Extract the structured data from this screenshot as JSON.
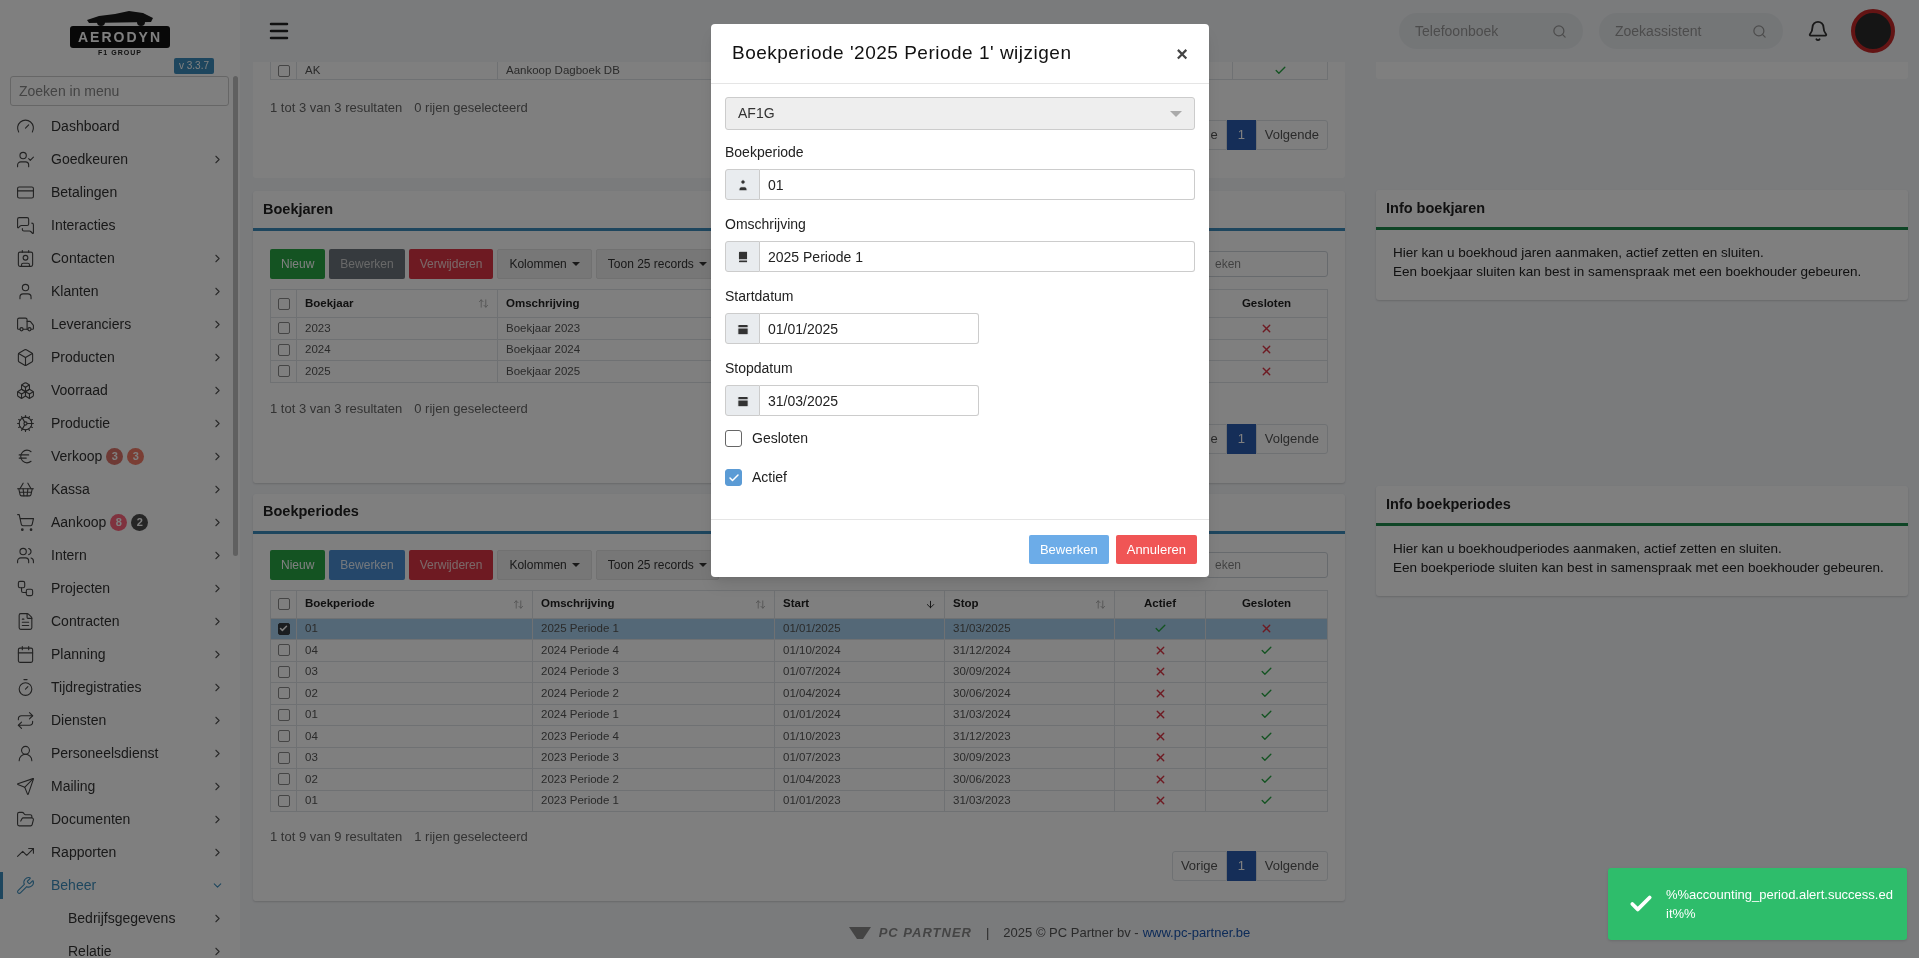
{
  "sidebar": {
    "logo": {
      "name": "AERODYN",
      "tagline": "F1 GROUP"
    },
    "version": "v 3.3.7",
    "search": {
      "placeholder": "Zoeken in menu"
    },
    "items": [
      {
        "label": "Dashboard",
        "selected": false
      },
      {
        "label": "Goedkeuren",
        "selected": false,
        "expanded": false
      },
      {
        "label": "Betalingen",
        "selected": false
      },
      {
        "label": "Interacties",
        "selected": false
      },
      {
        "label": "Contacten",
        "selected": false,
        "expanded": false
      },
      {
        "label": "Klanten",
        "selected": false,
        "expanded": false
      },
      {
        "label": "Leveranciers",
        "selected": false,
        "expanded": false
      },
      {
        "label": "Producten",
        "selected": false,
        "expanded": false
      },
      {
        "label": "Voorraad",
        "selected": false,
        "expanded": false
      },
      {
        "label": "Productie",
        "selected": false,
        "expanded": false
      },
      {
        "label": "Verkoop",
        "selected": false,
        "expanded": false,
        "badges": [
          {
            "text": "3",
            "color": "#6e3a35"
          },
          {
            "text": "3",
            "color": "#7a3e34"
          }
        ]
      },
      {
        "label": "Kassa",
        "selected": false,
        "expanded": false
      },
      {
        "label": "Aankoop",
        "selected": false,
        "expanded": false,
        "badges": [
          {
            "text": "8",
            "color": "#84323e"
          },
          {
            "text": "2",
            "color": "#262626"
          }
        ]
      },
      {
        "label": "Intern",
        "selected": false,
        "expanded": false
      },
      {
        "label": "Projecten",
        "selected": false,
        "expanded": false
      },
      {
        "label": "Contracten",
        "selected": false,
        "expanded": false
      },
      {
        "label": "Planning",
        "selected": false,
        "expanded": false
      },
      {
        "label": "Tijdregistraties",
        "selected": false,
        "expanded": false
      },
      {
        "label": "Diensten",
        "selected": false,
        "expanded": false
      },
      {
        "label": "Personeelsdienst",
        "selected": false,
        "expanded": false
      },
      {
        "label": "Mailing",
        "selected": false,
        "expanded": false
      },
      {
        "label": "Documenten",
        "selected": false,
        "expanded": false
      },
      {
        "label": "Rapporten",
        "selected": false,
        "expanded": false
      },
      {
        "label": "Beheer",
        "selected": true,
        "expanded": true,
        "children": [
          {
            "label": "Bedrijfsgegevens",
            "selected": false,
            "expanded": false
          },
          {
            "label": "Relatie",
            "selected": false,
            "expanded": false
          }
        ]
      }
    ]
  },
  "header": {
    "search_fields": [
      {
        "placeholder": "Telefoonboek"
      },
      {
        "placeholder": "Zoekassistent"
      }
    ]
  },
  "journals_panel": {
    "rows": [
      {
        "code": "AK",
        "description": "Aankoop Dagboek DB",
        "selected": false,
        "column_4": true
      }
    ],
    "summary": "1 tot 3 van 3 resultaten",
    "selection": "0 rijen geselecteerd",
    "pagination": {
      "previous": "e",
      "pages": [
        {
          "label": "1",
          "selected": true
        }
      ],
      "next": "Volgende"
    }
  },
  "years_panel": {
    "title": "Boekjaren",
    "toolbar": [
      {
        "label": "Nieuw",
        "kind": "new"
      },
      {
        "label": "Bewerken",
        "kind": "edit",
        "disabled": true
      },
      {
        "label": "Verwijderen",
        "kind": "delete"
      },
      {
        "label": "Kolommen",
        "kind": "dropdown"
      },
      {
        "label": "Toon 25 records",
        "kind": "dropdown"
      }
    ],
    "search": {
      "placeholder": "eken"
    },
    "all_selected": false,
    "columns": [
      {
        "label": "Boekjaar",
        "sorted": false
      },
      {
        "label": "Omschrijving"
      },
      {
        "label": "Gesloten"
      }
    ],
    "rows": [
      {
        "year": "2023",
        "description": "Boekjaar 2023",
        "closed": false,
        "selected": false
      },
      {
        "year": "2024",
        "description": "Boekjaar 2024",
        "closed": false,
        "selected": false
      },
      {
        "year": "2025",
        "description": "Boekjaar 2025",
        "closed": false,
        "selected": false
      }
    ],
    "summary": "1 tot 3 van 3 resultaten",
    "selection": "0 rijen geselecteerd",
    "pagination": {
      "previous": "e",
      "pages": [
        {
          "label": "1",
          "selected": true
        }
      ],
      "next": "Volgende"
    }
  },
  "periods_panel": {
    "title": "Boekperiodes",
    "toolbar": [
      {
        "label": "Nieuw",
        "kind": "new"
      },
      {
        "label": "Bewerken",
        "kind": "edit",
        "disabled": false
      },
      {
        "label": "Verwijderen",
        "kind": "delete"
      },
      {
        "label": "Kolommen",
        "kind": "dropdown"
      },
      {
        "label": "Toon 25 records",
        "kind": "dropdown"
      }
    ],
    "search": {
      "placeholder": "eken"
    },
    "all_selected": false,
    "columns": [
      {
        "label": "Boekperiode",
        "sorted": false
      },
      {
        "label": "Omschrijving",
        "sorted": false
      },
      {
        "label": "Start",
        "sorted": true
      },
      {
        "label": "Stop",
        "sorted": false
      },
      {
        "label": "Actief"
      },
      {
        "label": "Gesloten"
      }
    ],
    "rows": [
      {
        "period": "01",
        "description": "2025 Periode 1",
        "start": "01/01/2025",
        "stop": "31/03/2025",
        "active": true,
        "closed": false,
        "selected": true
      },
      {
        "period": "04",
        "description": "2024 Periode 4",
        "start": "01/10/2024",
        "stop": "31/12/2024",
        "active": false,
        "closed": true,
        "selected": false
      },
      {
        "period": "03",
        "description": "2024 Periode 3",
        "start": "01/07/2024",
        "stop": "30/09/2024",
        "active": false,
        "closed": true,
        "selected": false
      },
      {
        "period": "02",
        "description": "2024 Periode 2",
        "start": "01/04/2024",
        "stop": "30/06/2024",
        "active": false,
        "closed": true,
        "selected": false
      },
      {
        "period": "01",
        "description": "2024 Periode 1",
        "start": "01/01/2024",
        "stop": "31/03/2024",
        "active": false,
        "closed": true,
        "selected": false
      },
      {
        "period": "04",
        "description": "2023 Periode 4",
        "start": "01/10/2023",
        "stop": "31/12/2023",
        "active": false,
        "closed": true,
        "selected": false
      },
      {
        "period": "03",
        "description": "2023 Periode 3",
        "start": "01/07/2023",
        "stop": "30/09/2023",
        "active": false,
        "closed": true,
        "selected": false
      },
      {
        "period": "02",
        "description": "2023 Periode 2",
        "start": "01/04/2023",
        "stop": "30/06/2023",
        "active": false,
        "closed": true,
        "selected": false
      },
      {
        "period": "01",
        "description": "2023 Periode 1",
        "start": "01/01/2023",
        "stop": "31/03/2023",
        "active": false,
        "closed": true,
        "selected": false
      }
    ],
    "summary": "1 tot 9 van 9 resultaten",
    "selection": "1 rijen geselecteerd",
    "pagination": {
      "previous": "Vorige",
      "pages": [
        {
          "label": "1",
          "selected": true
        }
      ],
      "next": "Volgende"
    }
  },
  "info_panels": [
    {
      "title": "Info boekjaren",
      "lines": [
        "Hier kan u boekhoud jaren aanmaken, actief zetten en sluiten.",
        "Een boekjaar sluiten kan best in samenspraak met een boekhouder gebeuren."
      ]
    },
    {
      "title": "Info boekperiodes",
      "lines": [
        "Hier kan u boekhoudperiodes aanmaken, actief zetten en sluiten.",
        "Een boekperiode sluiten kan best in samenspraak met een boekhouder gebeuren."
      ]
    }
  ],
  "footer": {
    "brand": "PC PARTNER",
    "separator": "|",
    "text": "2025 © PC Partner bv -",
    "link": "www.pc-partner.be"
  },
  "modal": {
    "title": "Boekperiode '2025 Periode 1' wijzigen",
    "close": "×",
    "select": {
      "value": "AF1G",
      "disabled": true
    },
    "fields": [
      {
        "label": "Boekperiode",
        "value": "01",
        "kind": "user"
      },
      {
        "label": "Omschrijving",
        "value": "2025 Periode 1",
        "kind": "text"
      },
      {
        "label": "Startdatum",
        "value": "01/01/2025",
        "kind": "date"
      },
      {
        "label": "Stopdatum",
        "value": "31/03/2025",
        "kind": "date"
      }
    ],
    "checkboxes": [
      {
        "label": "Gesloten",
        "checked": false
      },
      {
        "label": "Actief",
        "checked": true
      }
    ],
    "buttons": [
      {
        "label": "Bewerken",
        "kind": "primary"
      },
      {
        "label": "Annuleren",
        "kind": "danger"
      }
    ]
  },
  "toast": {
    "message": "%%accounting_period.alert.success.edit%%"
  }
}
